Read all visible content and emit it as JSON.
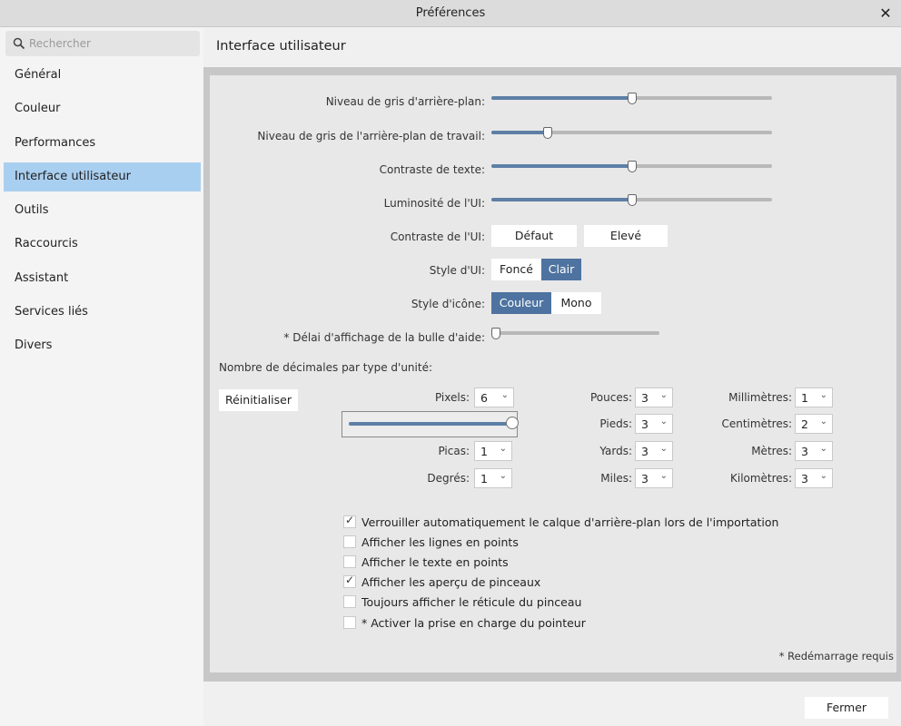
{
  "window": {
    "title": "Préférences",
    "close_icon": "close-icon"
  },
  "sidebar": {
    "search_placeholder": "Rechercher",
    "items": [
      {
        "label": "Général"
      },
      {
        "label": "Couleur"
      },
      {
        "label": "Performances"
      },
      {
        "label": "Interface utilisateur",
        "active": true
      },
      {
        "label": "Outils"
      },
      {
        "label": "Raccourcis"
      },
      {
        "label": "Assistant"
      },
      {
        "label": "Services liés"
      },
      {
        "label": "Divers"
      }
    ]
  },
  "main": {
    "title": "Interface utilisateur",
    "sliders": [
      {
        "label": "Niveau de gris d'arrière-plan:",
        "value": 0.5
      },
      {
        "label": "Niveau de gris de l'arrière-plan de travail:",
        "value": 0.2
      },
      {
        "label": "Contraste de texte:",
        "value": 0.5
      },
      {
        "label": "Luminosité de l'UI:",
        "value": 0.5
      }
    ],
    "ui_contrast": {
      "label": "Contraste de l'UI:",
      "options": [
        "Défaut",
        "Elevé"
      ]
    },
    "ui_style": {
      "label": "Style d'UI:",
      "options": [
        "Foncé",
        "Clair"
      ],
      "selected": "Clair"
    },
    "icon_style": {
      "label": "Style d'icône:",
      "options": [
        "Couleur",
        "Mono"
      ],
      "selected": "Couleur"
    },
    "tooltip_delay": {
      "label": "* Délai d'affichage de la bulle d'aide:",
      "value": 0.0
    },
    "decimals": {
      "heading": "Nombre de décimales par type d'unité:",
      "reset_label": "Réinitialiser",
      "pixels": {
        "label": "Pixels:",
        "value": "6",
        "slider": 1.0
      },
      "picas": {
        "label": "Picas:",
        "value": "1"
      },
      "degrees": {
        "label": "Degrés:",
        "value": "1"
      },
      "inches": {
        "label": "Pouces:",
        "value": "3"
      },
      "feet": {
        "label": "Pieds:",
        "value": "3"
      },
      "yards": {
        "label": "Yards:",
        "value": "3"
      },
      "miles": {
        "label": "Miles:",
        "value": "3"
      },
      "millimeters": {
        "label": "Millimètres:",
        "value": "1"
      },
      "centimeters": {
        "label": "Centimètres:",
        "value": "2"
      },
      "meters": {
        "label": "Mètres:",
        "value": "3"
      },
      "kilometers": {
        "label": "Kilomètres:",
        "value": "3"
      }
    },
    "checkboxes": [
      {
        "label": "Verrouiller automatiquement le calque d'arrière-plan lors de l'importation",
        "checked": true
      },
      {
        "label": "Afficher les lignes en points",
        "checked": false
      },
      {
        "label": "Afficher le texte en points",
        "checked": false
      },
      {
        "label": "Afficher les aperçu de pinceaux",
        "checked": true
      },
      {
        "label": "Toujours afficher le réticule du pinceau",
        "checked": false
      },
      {
        "label": "* Activer la prise en charge du pointeur",
        "checked": false
      }
    ],
    "restart_note": "* Redémarrage requis"
  },
  "footer": {
    "close_label": "Fermer"
  },
  "colors": {
    "accent": "#4e73a0",
    "selection": "#a9cff0",
    "slider_fill": "#5d7fa6"
  }
}
